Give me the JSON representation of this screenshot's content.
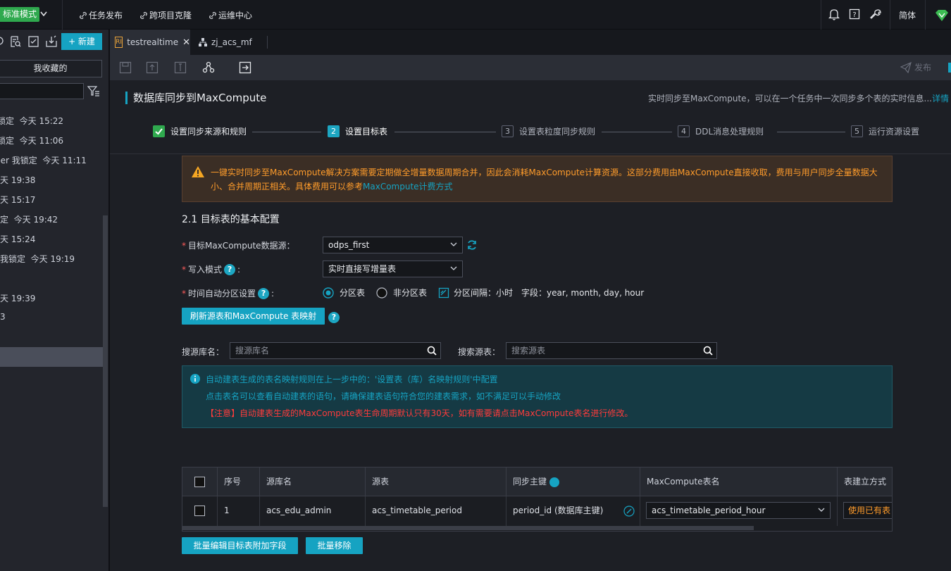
{
  "topbar": {
    "mode_label": "标准模式",
    "links": [
      "任务发布",
      "跨项目克隆",
      "运维中心"
    ],
    "language": "简体"
  },
  "sidebar": {
    "new_button": "+ 新建",
    "favorites": "我收藏的",
    "items": [
      {
        "prefix": "锁定",
        "time": "今天 15:22"
      },
      {
        "prefix": "锁定",
        "time": "今天 11:06"
      },
      {
        "prefix": "ner 我锁定",
        "time": "今天 11:11"
      },
      {
        "prefix": "",
        "time": "今天 19:38"
      },
      {
        "prefix": "",
        "time": "今天 15:17"
      },
      {
        "prefix": "锁定",
        "time": "今天 19:42"
      },
      {
        "prefix": "",
        "time": "今天 15:24"
      },
      {
        "prefix": "我锁定",
        "time": "今天 19:19"
      },
      {
        "prefix": "",
        "time": "今天 19:39"
      },
      {
        "prefix": "",
        "time": "3"
      }
    ]
  },
  "tabs": [
    {
      "label": "testrealtime",
      "icon": "RI",
      "active": true
    },
    {
      "label": "zj_acs_mf",
      "icon": "flow",
      "active": false
    }
  ],
  "toolbar": {
    "publish": "发布"
  },
  "page": {
    "title": "数据库同步到MaxCompute",
    "description": "实时同步至MaxCompute，可以在一个任务中一次同步多个表的实时信息...",
    "details_link": "详情"
  },
  "steps": [
    {
      "num": "1",
      "label": "设置同步来源和规则",
      "state": "done"
    },
    {
      "num": "2",
      "label": "设置目标表",
      "state": "active"
    },
    {
      "num": "3",
      "label": "设置表粒度同步规则",
      "state": "todo"
    },
    {
      "num": "4",
      "label": "DDL消息处理规则",
      "state": "todo"
    },
    {
      "num": "5",
      "label": "运行资源设置",
      "state": "todo"
    }
  ],
  "warning": {
    "line1": "一键实时同步至MaxCompute解决方案需要定期做全增量数据周期合并，因此会消耗MaxCompute计算资源。这部分费用由MaxCompute直接收取，费用与用户同步全量数据大",
    "line2_prefix": "小、合并周期正相关。具体费用可以参考",
    "line2_link": "MaxCompute计费方式"
  },
  "section": {
    "title": "2.1 目标表的基本配置",
    "datasource_label": "目标MaxCompute数据源：",
    "datasource_value": "odps_first",
    "write_mode_label": "写入模式",
    "write_mode_value": "实时直接写增量表",
    "partition_label": "时间自动分区设置",
    "partition_options": [
      "分区表",
      "非分区表"
    ],
    "partition_interval": "分区间隔：小时",
    "partition_fields": "字段：year, month, day, hour",
    "refresh_button": "刷新源表和MaxCompute 表映射"
  },
  "search": {
    "db_label": "搜源库名：",
    "db_placeholder": "搜源库名",
    "table_label": "搜索源表：",
    "table_placeholder": "搜索源表"
  },
  "info": {
    "line1": "自动建表生成的表名映射规则在上一步中的：'设置表（库）名映射规则'中配置",
    "line2": "点击表名可以查看自动建表的语句，请确保建表语句符合您的建表需求，如不满足可以手动修改",
    "line3": "【注意】自动建表生成的MaxCompute表生命周期默认只有30天，如有需要请点击MaxCompute表名进行修改。"
  },
  "table": {
    "headers": [
      "序号",
      "源库名",
      "源表",
      "同步主键",
      "MaxCompute表名",
      "表建立方式"
    ],
    "rows": [
      {
        "index": "1",
        "source_db": "acs_edu_admin",
        "source_table": "acs_timetable_period",
        "primary_key": "period_id (数据库主键)",
        "mc_table": "acs_timetable_period_hour",
        "create_mode": "使用已有表"
      }
    ]
  },
  "bottom_buttons": [
    "批量编辑目标表附加字段",
    "批量移除"
  ],
  "colors": {
    "accent": "#16a3c2",
    "success": "#2fa94e",
    "warning_text": "#ff9c2b",
    "danger_text": "#ff3b3b"
  }
}
